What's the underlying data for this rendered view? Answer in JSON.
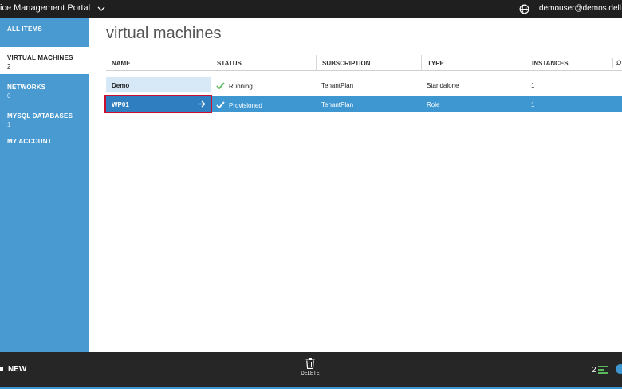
{
  "header": {
    "portal_title": "ice Management Portal",
    "user": "demouser@demos.dell.com",
    "icons": [
      "chevron-down-icon",
      "globe-icon"
    ]
  },
  "sidebar": {
    "items": [
      {
        "label": "ALL ITEMS",
        "count": ""
      },
      {
        "label": "VIRTUAL MACHINES",
        "count": "2"
      },
      {
        "label": "NETWORKS",
        "count": "0"
      },
      {
        "label": "MYSQL DATABASES",
        "count": "1"
      },
      {
        "label": "MY ACCOUNT",
        "count": ""
      }
    ],
    "active": "VIRTUAL MACHINES"
  },
  "main": {
    "title": "virtual machines",
    "columns": [
      "NAME",
      "STATUS",
      "SUBSCRIPTION",
      "TYPE",
      "INSTANCES"
    ],
    "rows": [
      {
        "name": "Demo",
        "status": "Running",
        "subscription": "TenantPlan",
        "type": "Standalone",
        "instances": "1"
      },
      {
        "name": "WP01",
        "status": "Provisioned",
        "subscription": "TenantPlan",
        "type": "Role",
        "instances": "1"
      }
    ],
    "selected_row": "WP01"
  },
  "footer": {
    "new_label": "NEW",
    "delete_label": "DELETE",
    "jobs_count": "2"
  },
  "colors": {
    "sidebar": "#4a9ad2",
    "selected_row": "#3e97d1",
    "highlight_outline": "#c8102e",
    "topbar": "#1f1f1f",
    "bottombar": "#262626",
    "check": "#5cb85c"
  }
}
